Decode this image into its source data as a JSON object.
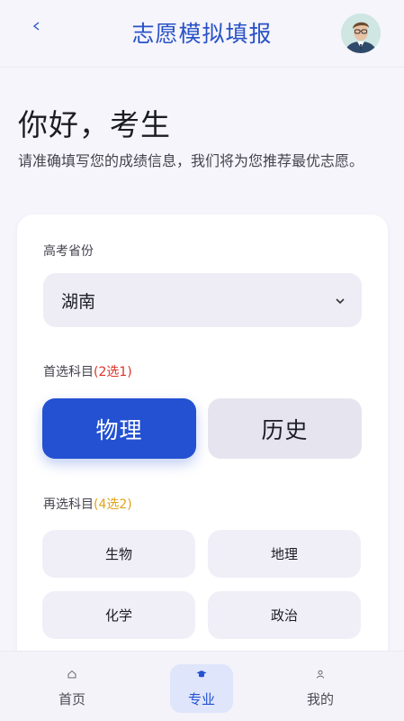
{
  "header": {
    "back_icon": "arrow-left-icon",
    "title": "志愿模拟填报",
    "avatar_icon": "user-avatar"
  },
  "greeting": {
    "title": "你好，考生",
    "subtitle": "请准确填写您的成绩信息，我们将为您推荐最优志愿。"
  },
  "form": {
    "province": {
      "label": "高考省份",
      "value": "湖南",
      "icon": "chevron-down-icon"
    },
    "primary_subject": {
      "label": "首选科目",
      "hint": "(2选1)",
      "hint_color": "#d9342b",
      "options": [
        "物理",
        "历史"
      ],
      "selected": "物理"
    },
    "secondary_subject": {
      "label": "再选科目",
      "hint": "(4选2)",
      "hint_color": "#e0a317",
      "options": [
        "生物",
        "地理",
        "化学",
        "政治"
      ]
    }
  },
  "bottom_nav": {
    "items": [
      {
        "label": "首页",
        "icon": "home-icon"
      },
      {
        "label": "专业",
        "icon": "graduation-cap-icon"
      },
      {
        "label": "我的",
        "icon": "user-icon"
      }
    ],
    "active": "专业"
  },
  "colors": {
    "accent": "#2351d2",
    "title_blue": "#2852c6",
    "background": "#f6f5fb"
  }
}
